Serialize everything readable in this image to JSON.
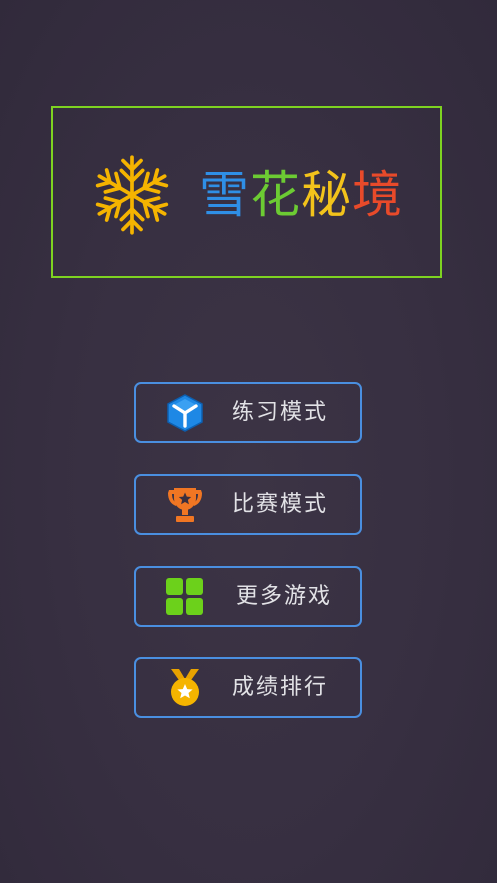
{
  "title": {
    "chars": [
      "雪",
      "花",
      "秘",
      "境"
    ],
    "colors": [
      "#2f8fe6",
      "#6ccb33",
      "#f3c31b",
      "#e84a2a"
    ]
  },
  "menu": [
    {
      "id": "practice",
      "label": "练习模式",
      "icon": "cube-icon"
    },
    {
      "id": "match",
      "label": "比赛模式",
      "icon": "trophy-icon"
    },
    {
      "id": "more",
      "label": "更多游戏",
      "icon": "grid-icon"
    },
    {
      "id": "rank",
      "label": "成绩排行",
      "icon": "medal-icon"
    }
  ],
  "colors": {
    "frame": "#7ed321",
    "button_border": "#4a8fe0",
    "snowflake": "#f5b400"
  }
}
